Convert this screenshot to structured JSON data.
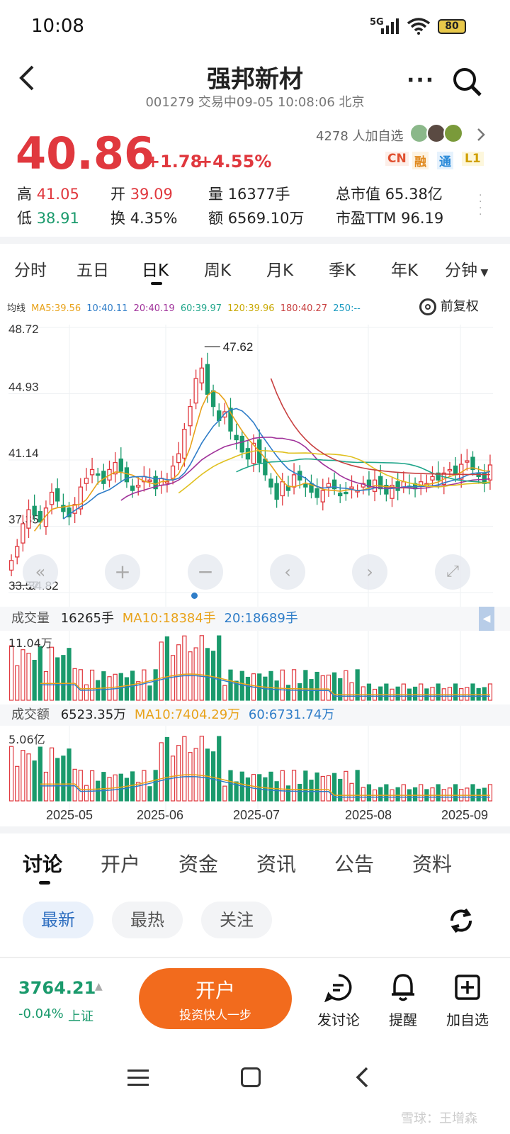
{
  "status_bar": {
    "time": "10:08",
    "network": "5G",
    "battery": "80"
  },
  "header": {
    "title": "强邦新材",
    "subtitle": "001279 交易中09-05 10:08:06 北京"
  },
  "quote": {
    "price": "40.86",
    "change": "+1.78",
    "change_pct": "+4.55%",
    "followers": "4278 人加自选",
    "badges": [
      "CN",
      "融",
      "通",
      "L1"
    ],
    "stats": [
      {
        "label": "高",
        "value": "41.05",
        "tone": "red"
      },
      {
        "label": "开",
        "value": "39.09",
        "tone": "red"
      },
      {
        "label": "量",
        "value": "16377手",
        "tone": ""
      },
      {
        "label": "总市值",
        "value": "65.38亿",
        "tone": ""
      },
      {
        "label": "低",
        "value": "38.91",
        "tone": "green"
      },
      {
        "label": "换",
        "value": "4.35%",
        "tone": ""
      },
      {
        "label": "额",
        "value": "6569.10万",
        "tone": ""
      },
      {
        "label": "市盈TTM",
        "value": "96.19",
        "tone": ""
      }
    ]
  },
  "period_tabs": [
    "分时",
    "五日",
    "日K",
    "周K",
    "月K",
    "季K",
    "年K",
    "分钟"
  ],
  "active_period": "日K",
  "ma_legend": {
    "label": "均线",
    "ma5": "MA5:39.56",
    "ma10": "10:40.11",
    "ma20": "20:40.19",
    "ma60": "60:39.97",
    "ma120": "120:39.96",
    "ma180": "180:40.27",
    "ma250": "250:--",
    "adjust": "前复权"
  },
  "colors": {
    "up": "#e0383e",
    "down": "#1a9a6c",
    "ma5": "#e8a21a",
    "ma10": "#2f7dc8",
    "ma20": "#a0329a",
    "ma60": "#1fa58a",
    "ma120": "#e0c020",
    "ma180": "#c84040",
    "accent": "#f26b1d"
  },
  "chart_data": {
    "type": "candlestick",
    "price_axis_labels": [
      "48.72",
      "44.93",
      "41.14",
      "37.35",
      "33.57"
    ],
    "max_marker": "47.62",
    "min_marker": "34.82",
    "x_labels": [
      "2025-05",
      "2025-06",
      "2025-07",
      "2025-08",
      "2025-09"
    ],
    "closes": [
      35.4,
      36.2,
      37.5,
      38.3,
      38.0,
      37.6,
      38.4,
      39.3,
      38.8,
      38.2,
      37.9,
      38.6,
      39.6,
      40.1,
      40.6,
      40.3,
      39.8,
      40.6,
      41.0,
      40.5,
      39.9,
      39.4,
      39.7,
      40.2,
      40.0,
      39.5,
      40.1,
      39.9,
      40.8,
      41.5,
      42.9,
      44.2,
      45.8,
      46.4,
      44.9,
      44.2,
      43.4,
      43.9,
      42.8,
      42.3,
      41.6,
      41.2,
      42.1,
      41.0,
      40.3,
      39.6,
      38.9,
      39.9,
      39.4,
      40.3,
      40.0,
      39.6,
      39.3,
      39.0,
      39.4,
      39.8,
      39.5,
      39.1,
      39.3,
      39.6,
      39.4,
      39.8,
      39.6,
      40.0,
      39.5,
      39.2,
      39.7,
      39.4,
      39.9,
      39.6,
      39.5,
      39.9,
      39.8,
      40.2,
      40.0,
      40.4,
      40.6,
      40.3,
      40.9,
      41.1,
      40.6,
      40.2,
      39.8,
      40.86
    ],
    "volume_legend": {
      "label": "成交量",
      "value": "16265手",
      "ma10": "MA10:18384手",
      "ma20": "20:18689手",
      "axis_max": "11.04万"
    },
    "amount_legend": {
      "label": "成交额",
      "value": "6523.35万",
      "ma10": "MA10:7404.29万",
      "ma60": "60:6731.74万",
      "axis_max": "5.06亿"
    }
  },
  "news_tabs": [
    "讨论",
    "开户",
    "资金",
    "资讯",
    "公告",
    "资料"
  ],
  "filter_chips": [
    "最新",
    "最热",
    "关注"
  ],
  "index": {
    "value": "3764.21",
    "change": "-0.04%",
    "name": "上证"
  },
  "open_account": {
    "title": "开户",
    "subtitle": "投资快人一步"
  },
  "actions": [
    "发讨论",
    "提醒",
    "加自选"
  ],
  "watermark": "雪球：王增森"
}
